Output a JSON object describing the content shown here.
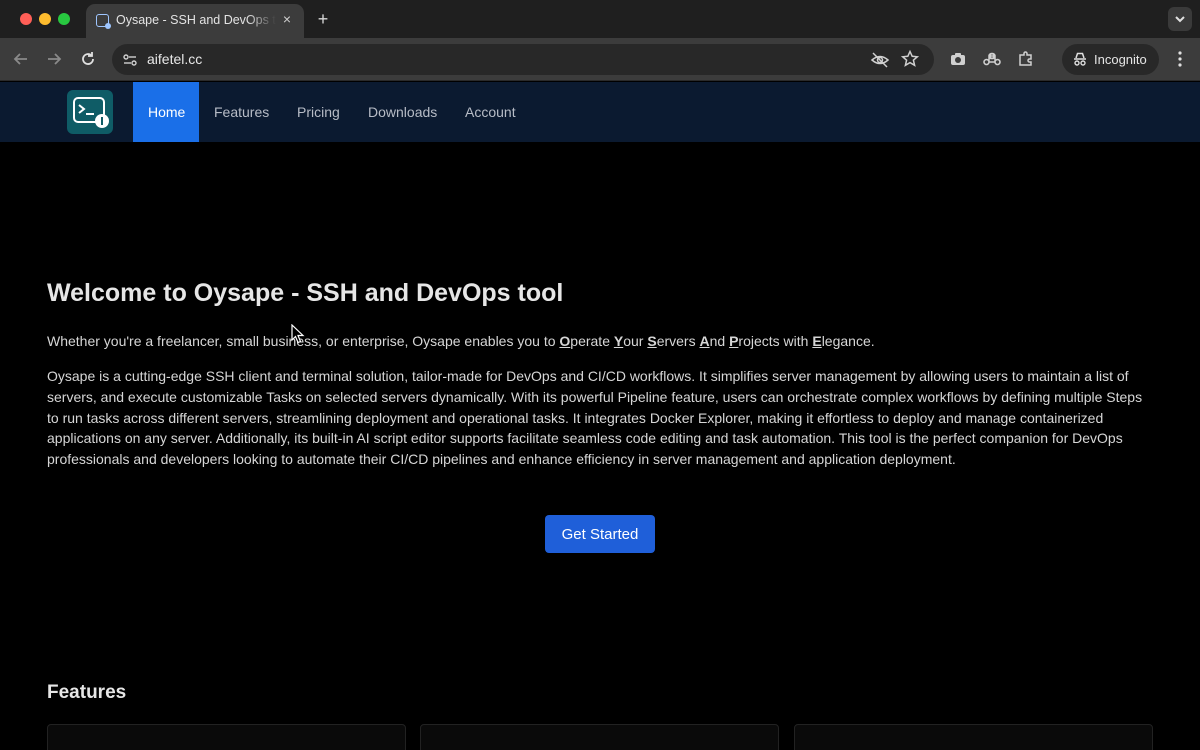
{
  "browser": {
    "tab_title": "Oysape - SSH and DevOps tool",
    "url": "aifetel.cc",
    "mode_label": "Incognito",
    "tab_close_glyph": "×",
    "new_tab_glyph": "+"
  },
  "nav": {
    "items": [
      {
        "label": "Home",
        "active": true
      },
      {
        "label": "Features",
        "active": false
      },
      {
        "label": "Pricing",
        "active": false
      },
      {
        "label": "Downloads",
        "active": false
      },
      {
        "label": "Account",
        "active": false
      }
    ]
  },
  "hero": {
    "title": "Welcome to Oysape - SSH and DevOps tool",
    "intro": {
      "prefix": "Whether you're a freelancer, small business, or enterprise, Oysape enables you to ",
      "parts": [
        {
          "initial": "O",
          "rest": "perate "
        },
        {
          "initial": "Y",
          "rest": "our "
        },
        {
          "initial": "S",
          "rest": "ervers "
        },
        {
          "initial": "A",
          "rest": "nd "
        },
        {
          "initial": "P",
          "rest": "rojects with "
        },
        {
          "initial": "E",
          "rest": "legance."
        }
      ]
    },
    "description": "Oysape is a cutting-edge SSH client and terminal solution, tailor-made for DevOps and CI/CD workflows. It simplifies server management by allowing users to maintain a list of servers, and execute customizable Tasks on selected servers dynamically. With its powerful Pipeline feature, users can orchestrate complex workflows by defining multiple Steps to run tasks across different servers, streamlining deployment and operational tasks. It integrates Docker Explorer, making it effortless to deploy and manage containerized applications on any server. Additionally, its built-in AI script editor supports facilitate seamless code editing and task automation. This tool is the perfect companion for DevOps professionals and developers looking to automate their CI/CD pipelines and enhance efficiency in server management and application deployment.",
    "cta_label": "Get Started"
  },
  "features": {
    "title": "Features"
  },
  "colors": {
    "page_bg": "#000000",
    "nav_bg": "#0b1a30",
    "nav_active": "#1a6fe8",
    "cta_bg": "#1f5fd9"
  }
}
